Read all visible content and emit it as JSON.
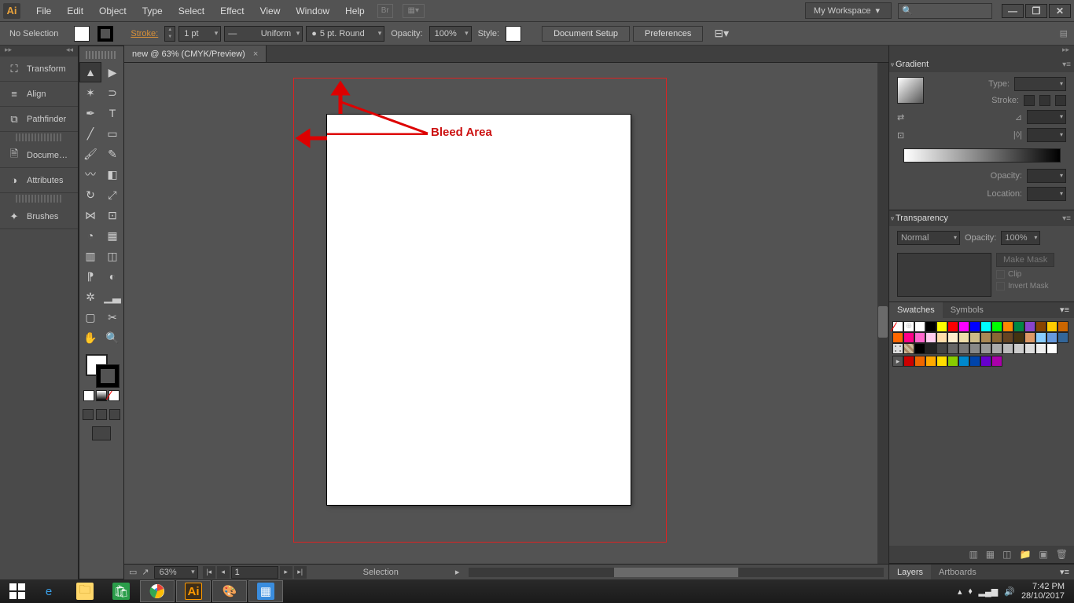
{
  "menubar": {
    "logo": "Ai",
    "items": [
      "File",
      "Edit",
      "Object",
      "Type",
      "Select",
      "Effect",
      "View",
      "Window",
      "Help"
    ],
    "workspace": "My Workspace",
    "search_placeholder": ""
  },
  "controlbar": {
    "selection": "No Selection",
    "stroke_label": "Stroke:",
    "stroke_weight": "1 pt",
    "stroke_profile": "Uniform",
    "brush": "5 pt. Round",
    "opacity_label": "Opacity:",
    "opacity": "100%",
    "style_label": "Style:",
    "doc_setup": "Document Setup",
    "prefs": "Preferences"
  },
  "left_panel": {
    "items": [
      "Transform",
      "Align",
      "Pathfinder",
      "Docume…",
      "Attributes",
      "Brushes"
    ]
  },
  "document": {
    "tab": "new @ 63% (CMYK/Preview)",
    "annotation": "Bleed Area"
  },
  "status": {
    "zoom": "63%",
    "page": "1",
    "tool": "Selection"
  },
  "gradient": {
    "title": "Gradient",
    "type_label": "Type:",
    "stroke_label": "Stroke:",
    "opacity_label": "Opacity:",
    "location_label": "Location:"
  },
  "transparency": {
    "title": "Transparency",
    "mode": "Normal",
    "opacity_label": "Opacity:",
    "opacity": "100%",
    "make_mask": "Make Mask",
    "clip": "Clip",
    "invert": "Invert Mask"
  },
  "swatches": {
    "tab1": "Swatches",
    "tab2": "Symbols",
    "colors_row1": [
      "#ffffff",
      "#000000",
      "#ffff00",
      "#ff0000",
      "#ff00ff",
      "#0000ff",
      "#00ffff",
      "#00ff00",
      "#ff8800",
      "#008844",
      "#8844cc",
      "#884400",
      "#ffcc00",
      "#cc6600",
      "#ff6600"
    ],
    "colors_row2": [
      "#ff0088",
      "#ff66cc",
      "#ffccee",
      "#ffddaa",
      "#ffeecc",
      "#eeddaa",
      "#ccbb88",
      "#aa8855",
      "#886633",
      "#664422",
      "#443311",
      "#dd9966",
      "#88ccff",
      "#6699dd",
      "#336699"
    ],
    "colors_row3": [
      "#000000",
      "#222222",
      "#444444",
      "#666666",
      "#777777",
      "#888888",
      "#999999",
      "#aaaaaa",
      "#bbbbbb",
      "#cccccc",
      "#dddddd",
      "#eeeeee",
      "#ffffff"
    ],
    "colors_row4": [
      "#cc0000",
      "#ee6600",
      "#ffaa00",
      "#ffdd00",
      "#88cc00",
      "#0088cc",
      "#0044aa",
      "#6600cc",
      "#aa00aa"
    ]
  },
  "bottom_tabs": {
    "tab1": "Layers",
    "tab2": "Artboards"
  },
  "taskbar": {
    "time": "7:42 PM",
    "date": "28/10/2017"
  }
}
